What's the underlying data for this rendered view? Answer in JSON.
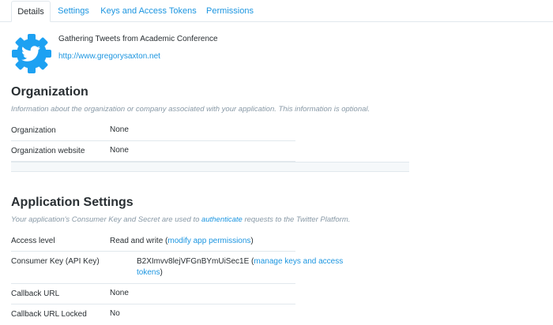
{
  "tabs": [
    {
      "label": "Details",
      "active": true
    },
    {
      "label": "Settings",
      "active": false
    },
    {
      "label": "Keys and Access Tokens",
      "active": false
    },
    {
      "label": "Permissions",
      "active": false
    }
  ],
  "app": {
    "name": "Gathering Tweets from Academic Conference",
    "url": "http://www.gregorysaxton.net",
    "logo_icon": "twitter-bird-gear-icon"
  },
  "organization": {
    "heading": "Organization",
    "description": "Information about the organization or company associated with your application. This information is optional.",
    "rows": [
      {
        "label": "Organization",
        "value": "None"
      },
      {
        "label": "Organization website",
        "value": "None"
      }
    ]
  },
  "app_settings": {
    "heading": "Application Settings",
    "description_pre": "Your application's Consumer Key and Secret are used to ",
    "description_link": "authenticate",
    "description_post": " requests to the Twitter Platform.",
    "access_level": {
      "label": "Access level",
      "value": "Read and write",
      "link": "modify app permissions"
    },
    "consumer_key": {
      "label": "Consumer Key (API Key)",
      "value": "B2XImvv8lejVFGnBYmUiSec1E",
      "link_line1": "manage keys and access",
      "link_line2": "tokens"
    },
    "callback_url": {
      "label": "Callback URL",
      "value": "None"
    },
    "callback_locked": {
      "label": "Callback URL Locked",
      "value": "No"
    }
  },
  "colors": {
    "link": "#1b95e0",
    "text": "#292f33",
    "muted": "#8899a6",
    "logo": "#1da1f2"
  }
}
